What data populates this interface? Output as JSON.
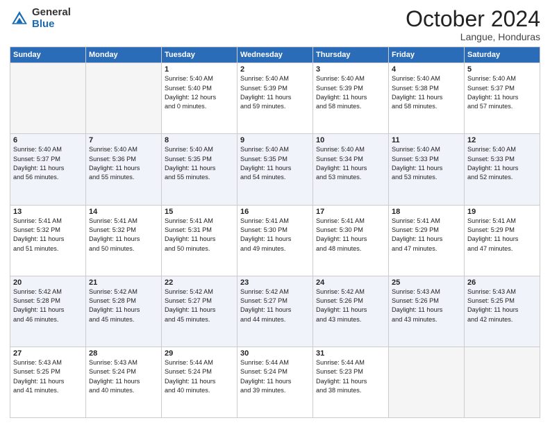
{
  "logo": {
    "line1": "General",
    "line2": "Blue"
  },
  "title": "October 2024",
  "subtitle": "Langue, Honduras",
  "days_header": [
    "Sunday",
    "Monday",
    "Tuesday",
    "Wednesday",
    "Thursday",
    "Friday",
    "Saturday"
  ],
  "weeks": [
    [
      {
        "day": "",
        "info": ""
      },
      {
        "day": "",
        "info": ""
      },
      {
        "day": "1",
        "info": "Sunrise: 5:40 AM\nSunset: 5:40 PM\nDaylight: 12 hours\nand 0 minutes."
      },
      {
        "day": "2",
        "info": "Sunrise: 5:40 AM\nSunset: 5:39 PM\nDaylight: 11 hours\nand 59 minutes."
      },
      {
        "day": "3",
        "info": "Sunrise: 5:40 AM\nSunset: 5:39 PM\nDaylight: 11 hours\nand 58 minutes."
      },
      {
        "day": "4",
        "info": "Sunrise: 5:40 AM\nSunset: 5:38 PM\nDaylight: 11 hours\nand 58 minutes."
      },
      {
        "day": "5",
        "info": "Sunrise: 5:40 AM\nSunset: 5:37 PM\nDaylight: 11 hours\nand 57 minutes."
      }
    ],
    [
      {
        "day": "6",
        "info": "Sunrise: 5:40 AM\nSunset: 5:37 PM\nDaylight: 11 hours\nand 56 minutes."
      },
      {
        "day": "7",
        "info": "Sunrise: 5:40 AM\nSunset: 5:36 PM\nDaylight: 11 hours\nand 55 minutes."
      },
      {
        "day": "8",
        "info": "Sunrise: 5:40 AM\nSunset: 5:35 PM\nDaylight: 11 hours\nand 55 minutes."
      },
      {
        "day": "9",
        "info": "Sunrise: 5:40 AM\nSunset: 5:35 PM\nDaylight: 11 hours\nand 54 minutes."
      },
      {
        "day": "10",
        "info": "Sunrise: 5:40 AM\nSunset: 5:34 PM\nDaylight: 11 hours\nand 53 minutes."
      },
      {
        "day": "11",
        "info": "Sunrise: 5:40 AM\nSunset: 5:33 PM\nDaylight: 11 hours\nand 53 minutes."
      },
      {
        "day": "12",
        "info": "Sunrise: 5:40 AM\nSunset: 5:33 PM\nDaylight: 11 hours\nand 52 minutes."
      }
    ],
    [
      {
        "day": "13",
        "info": "Sunrise: 5:41 AM\nSunset: 5:32 PM\nDaylight: 11 hours\nand 51 minutes."
      },
      {
        "day": "14",
        "info": "Sunrise: 5:41 AM\nSunset: 5:32 PM\nDaylight: 11 hours\nand 50 minutes."
      },
      {
        "day": "15",
        "info": "Sunrise: 5:41 AM\nSunset: 5:31 PM\nDaylight: 11 hours\nand 50 minutes."
      },
      {
        "day": "16",
        "info": "Sunrise: 5:41 AM\nSunset: 5:30 PM\nDaylight: 11 hours\nand 49 minutes."
      },
      {
        "day": "17",
        "info": "Sunrise: 5:41 AM\nSunset: 5:30 PM\nDaylight: 11 hours\nand 48 minutes."
      },
      {
        "day": "18",
        "info": "Sunrise: 5:41 AM\nSunset: 5:29 PM\nDaylight: 11 hours\nand 47 minutes."
      },
      {
        "day": "19",
        "info": "Sunrise: 5:41 AM\nSunset: 5:29 PM\nDaylight: 11 hours\nand 47 minutes."
      }
    ],
    [
      {
        "day": "20",
        "info": "Sunrise: 5:42 AM\nSunset: 5:28 PM\nDaylight: 11 hours\nand 46 minutes."
      },
      {
        "day": "21",
        "info": "Sunrise: 5:42 AM\nSunset: 5:28 PM\nDaylight: 11 hours\nand 45 minutes."
      },
      {
        "day": "22",
        "info": "Sunrise: 5:42 AM\nSunset: 5:27 PM\nDaylight: 11 hours\nand 45 minutes."
      },
      {
        "day": "23",
        "info": "Sunrise: 5:42 AM\nSunset: 5:27 PM\nDaylight: 11 hours\nand 44 minutes."
      },
      {
        "day": "24",
        "info": "Sunrise: 5:42 AM\nSunset: 5:26 PM\nDaylight: 11 hours\nand 43 minutes."
      },
      {
        "day": "25",
        "info": "Sunrise: 5:43 AM\nSunset: 5:26 PM\nDaylight: 11 hours\nand 43 minutes."
      },
      {
        "day": "26",
        "info": "Sunrise: 5:43 AM\nSunset: 5:25 PM\nDaylight: 11 hours\nand 42 minutes."
      }
    ],
    [
      {
        "day": "27",
        "info": "Sunrise: 5:43 AM\nSunset: 5:25 PM\nDaylight: 11 hours\nand 41 minutes."
      },
      {
        "day": "28",
        "info": "Sunrise: 5:43 AM\nSunset: 5:24 PM\nDaylight: 11 hours\nand 40 minutes."
      },
      {
        "day": "29",
        "info": "Sunrise: 5:44 AM\nSunset: 5:24 PM\nDaylight: 11 hours\nand 40 minutes."
      },
      {
        "day": "30",
        "info": "Sunrise: 5:44 AM\nSunset: 5:24 PM\nDaylight: 11 hours\nand 39 minutes."
      },
      {
        "day": "31",
        "info": "Sunrise: 5:44 AM\nSunset: 5:23 PM\nDaylight: 11 hours\nand 38 minutes."
      },
      {
        "day": "",
        "info": ""
      },
      {
        "day": "",
        "info": ""
      }
    ]
  ]
}
